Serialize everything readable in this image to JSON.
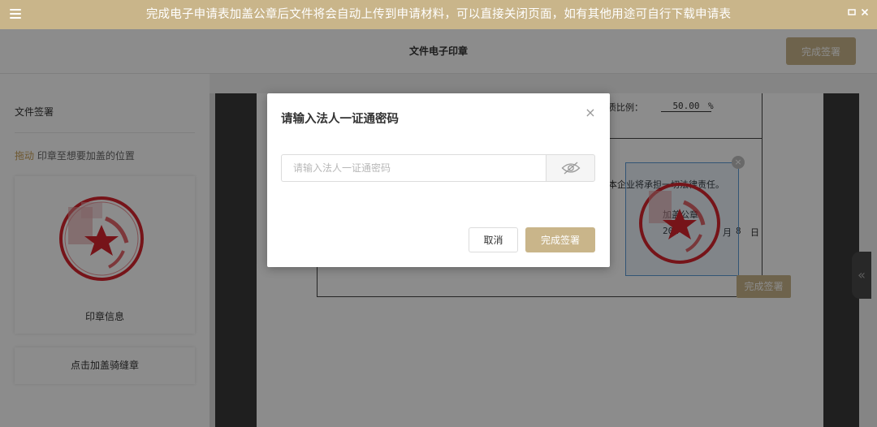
{
  "window": {
    "title": "完成电子申请表加盖公章后文件将会自动上传到申请材料，可以直接关闭页面，如有其他用途可自行下载申请表",
    "icons": [
      "menu-icon",
      "maximize-icon",
      "close-icon"
    ]
  },
  "header": {
    "title": "文件电子印章",
    "finish_label": "完成签署"
  },
  "left_panel": {
    "title": "文件签署",
    "hint_accent": "拖动",
    "hint_rest": " 印章至想要加盖的位置",
    "seal_caption": "印章信息",
    "riding_seal_label": "点击加盖骑缝章"
  },
  "document": {
    "ratio_label": "质比例：",
    "ratio_value": "50.00",
    "ratio_unit": "%",
    "liability_text": "，本企业将承担一切法律责任。",
    "stamp_text": "加盖公章",
    "date_year": "202",
    "date_month": "月",
    "date_day_value": "8",
    "date_day": "日"
  },
  "placed_seal": {
    "confirm_label": "完成签署",
    "close_icon": "×"
  },
  "modal": {
    "title": "请输入法人一证通密码",
    "password_placeholder": "请输入法人一证通密码",
    "password_value": "",
    "cancel_label": "取消",
    "confirm_label": "完成签署",
    "close_icon": "×"
  },
  "colors": {
    "accent": "#c9b58a",
    "seal_red": "#d7262e",
    "selection_blue": "#5b9bd5"
  }
}
